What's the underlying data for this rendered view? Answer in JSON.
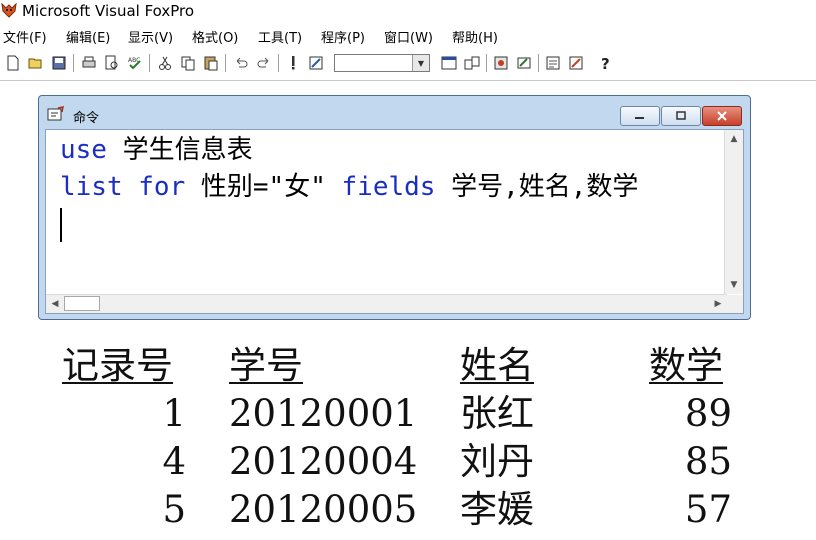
{
  "app": {
    "title": "Microsoft Visual FoxPro"
  },
  "menu": [
    "文件(F)",
    "编辑(E)",
    "显示(V)",
    "格式(O)",
    "工具(T)",
    "程序(P)",
    "窗口(W)",
    "帮助(H)"
  ],
  "toolbar": {
    "buttons": [
      "new-icon",
      "open-icon",
      "save-icon",
      "print-icon",
      "print-preview-icon",
      "spell-check-icon",
      "cut-icon",
      "copy-icon",
      "paste-icon",
      "undo-icon",
      "redo-icon",
      "run-icon",
      "modify-form-icon",
      "command-window-icon",
      "data-session-icon",
      "form-designer-icon",
      "form-wizard-icon",
      "report-wizard-icon",
      "help-icon"
    ],
    "combo_value": ""
  },
  "command_window": {
    "title": "命令",
    "lines": [
      {
        "keyword": "use",
        "rest": " 学生信息表"
      },
      {
        "keyword": "list for",
        "rest": " 性别=\"女\" ",
        "keyword2": "fields",
        "rest2": " 学号,姓名,数学"
      }
    ]
  },
  "output": {
    "headers": [
      "记录号",
      "学号",
      "姓名",
      "数学"
    ],
    "rows": [
      [
        "1",
        "20120001",
        "张红",
        "89"
      ],
      [
        "4",
        "20120004",
        "刘丹",
        "85"
      ],
      [
        "5",
        "20120005",
        "李媛",
        "57"
      ]
    ]
  }
}
